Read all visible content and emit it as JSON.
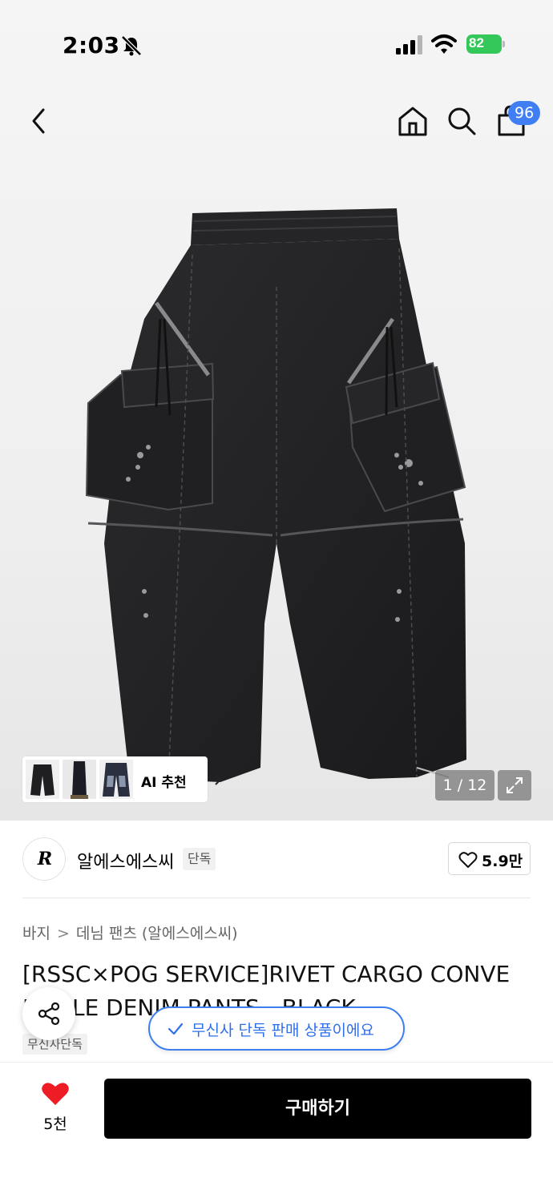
{
  "status_bar": {
    "time": "2:03",
    "battery": "82"
  },
  "header": {
    "cart_badge": "96"
  },
  "gallery": {
    "ai_label": "AI 추천",
    "counter": "1 / 12"
  },
  "brand": {
    "logo_text": "R",
    "name": "알에스에스씨",
    "exclusive_tag": "단독",
    "like_count": "5.9만"
  },
  "breadcrumb": {
    "category": "바지",
    "subcategory": "데님 팬츠 (알에스에스씨)"
  },
  "product": {
    "title_line1": "[RSSC×POG SERVICE]RIVET CARGO CONVE",
    "title_line2": "RTIBLE DENIM PANTS - BLACK",
    "store_tag": "무신사단독"
  },
  "banner": {
    "text": "무신사 단독 판매 상품이에요"
  },
  "bottom": {
    "fav_count": "5천",
    "buy_label": "구매하기"
  },
  "colors": {
    "accent_blue": "#3d7ff0",
    "battery_green": "#34c759",
    "heart_red": "#ee1c25",
    "buy_black": "#000000"
  }
}
